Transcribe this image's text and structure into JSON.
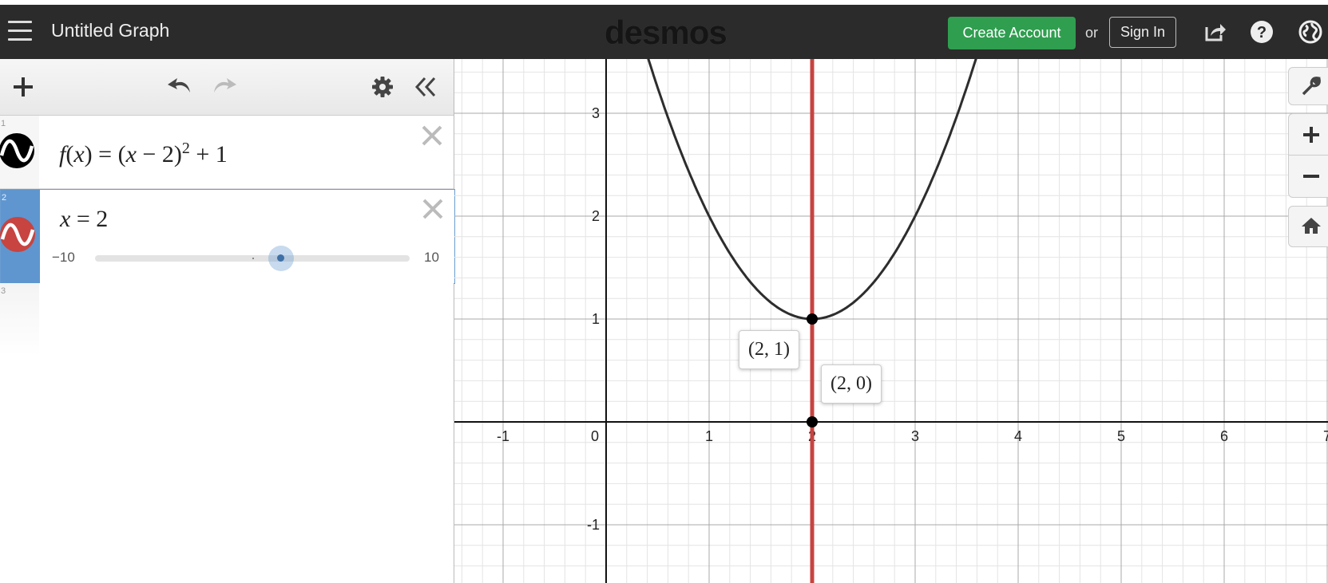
{
  "header": {
    "title": "Untitled Graph",
    "logo": "desmos",
    "create_account_label": "Create Account",
    "or_label": "or",
    "sign_in_label": "Sign In",
    "accent_green": "#2f9e4f",
    "icons": [
      "menu-icon",
      "share-icon",
      "help-icon",
      "language-globe-icon"
    ]
  },
  "toolbar": {
    "icons": [
      "add-icon",
      "undo-icon",
      "redo-icon",
      "settings-gear-icon",
      "collapse-panel-icon"
    ]
  },
  "expressions": [
    {
      "index": "1",
      "parts": {
        "fname": "f",
        "open": "(",
        "var": "x",
        "close": ")",
        "eq": " = (",
        "var2": "x",
        "minus": " − 2)",
        "exp": "2",
        "rest": " + 1"
      },
      "color": "#000000"
    },
    {
      "index": "2",
      "lhs": "x",
      "eq": " = ",
      "rhs": "2",
      "color": "#c74440",
      "slider": {
        "min": "−10",
        "max": "10",
        "value": 2
      }
    },
    {
      "index": "3"
    }
  ],
  "graph": {
    "x_ticks": [
      "-1",
      "0",
      "1",
      "2",
      "3",
      "4",
      "5",
      "6",
      "7"
    ],
    "y_ticks": [
      "3",
      "2",
      "1",
      "-1"
    ],
    "x_range": [
      -1.5,
      7
    ],
    "y_range": [
      -1.5,
      3.5
    ],
    "points": [
      {
        "label": "(2, 1)",
        "x": 2,
        "y": 1
      },
      {
        "label": "(2, 0)",
        "x": 2,
        "y": 0
      }
    ],
    "curve_color": "#2d2d2d",
    "line_color": "#c74440"
  },
  "side_controls": [
    "wrench-icon",
    "zoom-in-icon",
    "zoom-out-icon",
    "home-icon"
  ]
}
